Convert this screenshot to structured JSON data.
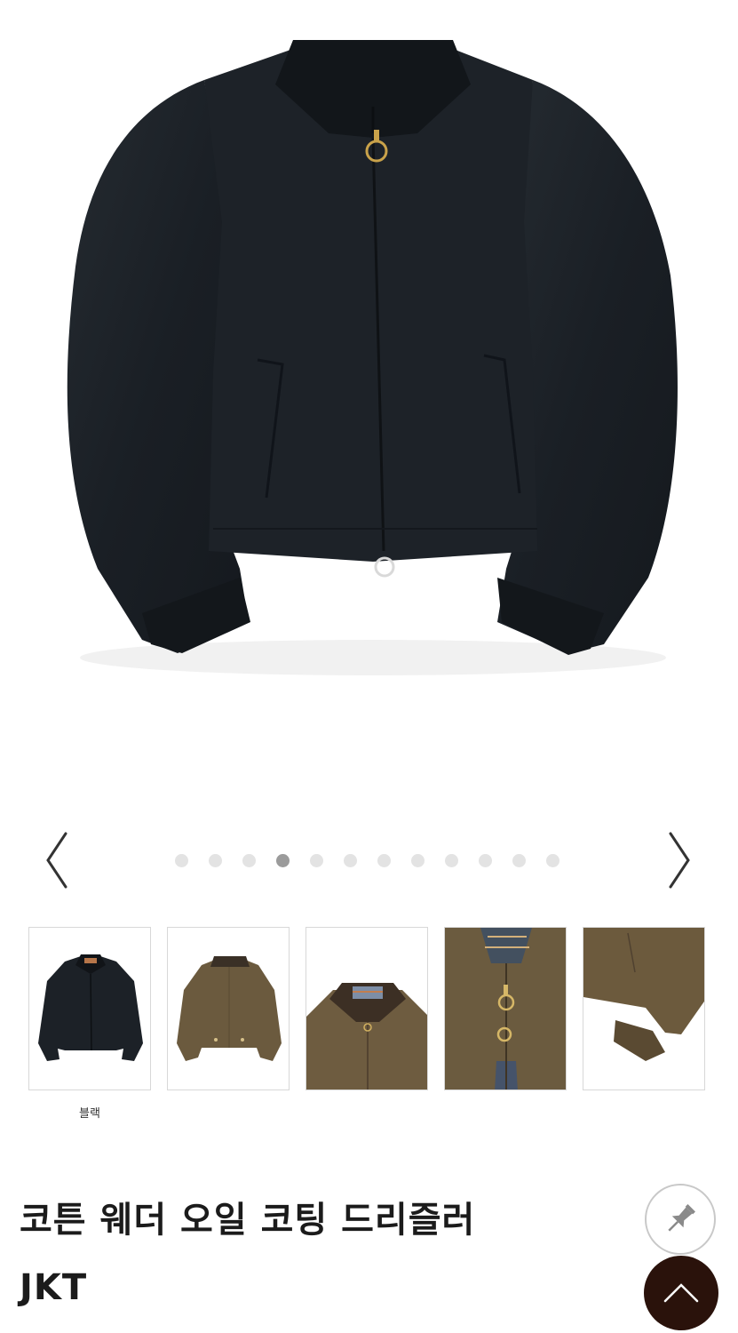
{
  "carousel": {
    "dot_count": 12,
    "active_index": 3,
    "prev_icon": "chevron-left-icon",
    "next_icon": "chevron-right-icon"
  },
  "thumbnails": [
    {
      "name": "thumb-black-front",
      "caption": "블랙"
    },
    {
      "name": "thumb-brown-back",
      "caption": ""
    },
    {
      "name": "thumb-brown-collar",
      "caption": ""
    },
    {
      "name": "thumb-brown-zipper",
      "caption": ""
    },
    {
      "name": "thumb-brown-cuff",
      "caption": ""
    }
  ],
  "product": {
    "title_line1": "코튼 웨더 오일 코팅 드리즐러",
    "title_line2": "JKT"
  },
  "buttons": {
    "pin_icon": "pin-icon",
    "scroll_top_icon": "chevron-up-icon"
  },
  "colors": {
    "jacket_black": "#1c2127",
    "jacket_brown": "#6b5a3e",
    "scroll_top_bg": "#2a120b"
  }
}
